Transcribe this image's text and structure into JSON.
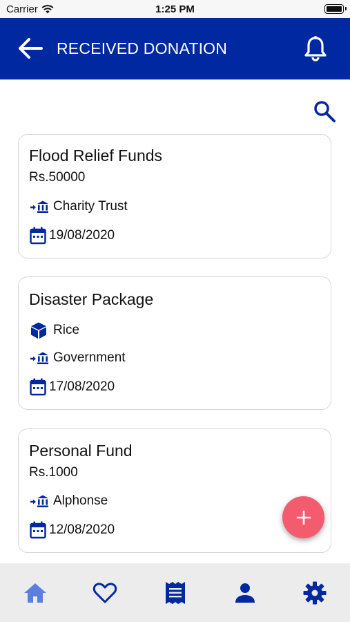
{
  "status_bar": {
    "carrier": "Carrier",
    "time": "1:25 PM"
  },
  "header": {
    "title": "RECEIVED DONATION",
    "back_icon": "arrow-left-icon",
    "bell_icon": "bell-icon",
    "background_color": "#0029a1"
  },
  "search": {
    "icon": "search-icon"
  },
  "donations": [
    {
      "title": "Flood Relief Funds",
      "amount": "Rs.50000",
      "donor": "Charity Trust",
      "date": "19/08/2020"
    },
    {
      "title": "Disaster Package",
      "item": "Rice",
      "donor": "Government",
      "date": "17/08/2020"
    },
    {
      "title": "Personal Fund",
      "amount": "Rs.1000",
      "donor": "Alphonse",
      "date": "12/08/2020"
    }
  ],
  "fab": {
    "icon": "plus-icon",
    "color": "#f25c6e"
  },
  "bottom_nav": {
    "items": [
      {
        "icon": "home-icon",
        "active": true
      },
      {
        "icon": "heart-icon"
      },
      {
        "icon": "receipt-icon"
      },
      {
        "icon": "person-icon"
      },
      {
        "icon": "gear-icon"
      }
    ]
  },
  "colors": {
    "accent": "#0029a1",
    "active_nav": "#5b7fe0"
  }
}
